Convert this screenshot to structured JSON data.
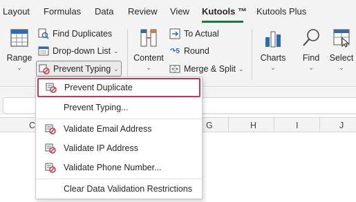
{
  "tabs": [
    {
      "label": "Layout"
    },
    {
      "label": "Formulas"
    },
    {
      "label": "Data"
    },
    {
      "label": "Review"
    },
    {
      "label": "View"
    },
    {
      "label": "Kutools ™",
      "active": true
    },
    {
      "label": "Kutools Plus"
    }
  ],
  "ribbon": {
    "range_label": "Range",
    "find_duplicates_label": "Find Duplicates",
    "dropdown_list_label": "Drop-down List",
    "prevent_typing_label": "Prevent Typing",
    "content_label": "Content",
    "to_actual_label": "To Actual",
    "round_label": "Round",
    "merge_split_label": "Merge & Split",
    "charts_label": "Charts",
    "find_label": "Find",
    "select_label": "Select"
  },
  "columns": [
    "C",
    "G",
    "H",
    "I",
    "J"
  ],
  "menu": {
    "items": [
      {
        "label": "Prevent Duplicate",
        "icon": "prevent-duplicate-icon",
        "highlighted": true
      },
      {
        "label": "Prevent Typing...",
        "icon": ""
      },
      {
        "label": "Validate Email Address",
        "icon": "validate-email-icon"
      },
      {
        "label": "Validate IP Address",
        "icon": "validate-ip-icon"
      },
      {
        "label": "Validate Phone Number...",
        "icon": "validate-phone-icon"
      },
      {
        "label": "Clear Data Validation Restrictions",
        "icon": ""
      }
    ]
  },
  "colors": {
    "accent_green": "#217346",
    "highlight_border": "#c9344a",
    "icon_blue": "#2b6cb0",
    "icon_red": "#d13438"
  }
}
